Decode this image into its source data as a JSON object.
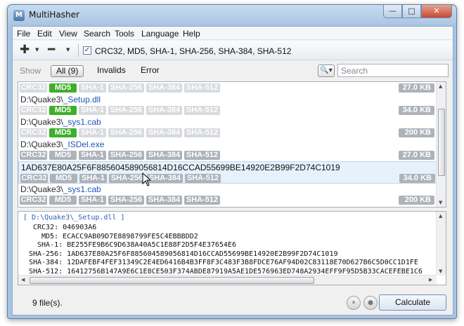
{
  "window": {
    "title": "MultiHasher",
    "app_icon_glyph": "M"
  },
  "window_controls": {
    "minimize": "—",
    "maximize": "□",
    "close": "✕"
  },
  "menu": {
    "items": [
      "File",
      "Edit",
      "View",
      "Search",
      "Tools",
      "Language",
      "Help"
    ]
  },
  "toolbar": {
    "add_icon": "plus-icon",
    "remove_icon": "minus-icon",
    "add_glyph": "✚",
    "remove_glyph": "━",
    "dropdown_glyph": "▼",
    "algorithms_checked": true,
    "check_glyph": "✓",
    "algorithms_label": "CRC32, MD5, SHA-1, SHA-256, SHA-384, SHA-512"
  },
  "filter": {
    "show_label": "Show",
    "all_label": "All (9)",
    "invalids_label": "Invalids",
    "error_label": "Error",
    "search_icon_glyph": "🔍▾",
    "search_placeholder": "Search"
  },
  "algorithms": [
    "CRC32",
    "MD5",
    "SHA-1",
    "SHA-256",
    "SHA-384",
    "SHA-512"
  ],
  "files": [
    {
      "path_prefix": "",
      "path_name": "",
      "states": [
        "light",
        "ok",
        "light",
        "light",
        "light",
        "light"
      ],
      "size": "27.0 KB"
    },
    {
      "path_prefix": "D:\\Quake3\\",
      "path_name": "_Setup.dll",
      "states": [
        "light",
        "ok",
        "light",
        "light",
        "light",
        "light"
      ],
      "size": "34.0 KB"
    },
    {
      "path_prefix": "D:\\Quake3\\",
      "path_name": "_sys1.cab",
      "states": [
        "light",
        "ok",
        "light",
        "light",
        "light",
        "light"
      ],
      "size": "200 KB"
    },
    {
      "path_prefix": "D:\\Quake3\\",
      "path_name": "_ISDel.exe",
      "states": [
        "gray",
        "gray",
        "gray",
        "gray",
        "gray",
        "gray"
      ],
      "size": "27.0 KB"
    },
    {
      "path_prefix": "1AD637E80A25F6F885604589056814D16CCAD55699BE14920E2B99F2D74C1019",
      "path_name": "",
      "states": [
        "gray",
        "gray",
        "gray",
        "gray",
        "gray",
        "gray"
      ],
      "size": "34.0 KB",
      "selected": true
    },
    {
      "path_prefix": "D:\\Quake3\\",
      "path_name": "_sys1.cab",
      "states": [
        "gray",
        "gray",
        "gray",
        "gray",
        "gray",
        "gray"
      ],
      "size": "200 KB"
    }
  ],
  "output": {
    "header": "[ D:\\Quake3\\_Setup.dll ]",
    "lines": [
      "CRC32: 046903A6",
      "MD5: ECACC9AB09D7E8898799FE5C4EBBBDD2",
      "SHA-1: BE255FE9B6C9D638A40A5C1E88F2D5F4E37654E6",
      "SHA-256: 1AD637E80A25F6F885604589056814D16CCAD55699BE14920E2B99F2D74C1019",
      "SHA-384: 12DAFEBF4FEF31349C2E4ED6416B4B3FF8F3C483F3B8FDCE76AF94D02C83118E70D627B6C5D0CC1D1FE",
      "SHA-512: 16412756B147A9E6C1E8CE503F374ABDE87919A5AE1DE576963ED748A2934EFF9F95D5B33CACEFEBE1C6"
    ]
  },
  "status": {
    "file_count": "9 file(s).",
    "pause_glyph": "⏸",
    "stop_glyph": "●",
    "calculate_label": "Calculate"
  }
}
